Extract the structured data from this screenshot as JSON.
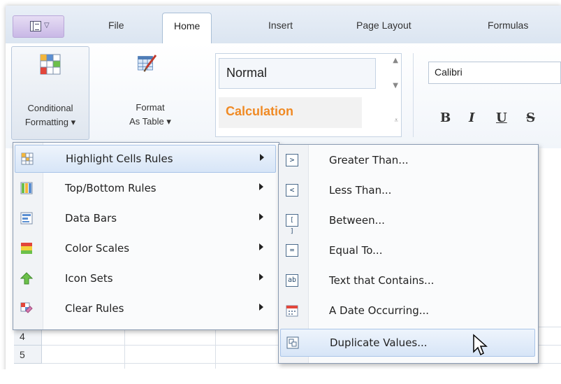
{
  "window": {
    "tabs": [
      {
        "label": "File",
        "active": false
      },
      {
        "label": "Home",
        "active": true
      },
      {
        "label": "Insert",
        "active": false
      },
      {
        "label": "Page Layout",
        "active": false
      },
      {
        "label": "Formulas",
        "active": false
      }
    ]
  },
  "ribbon": {
    "conditional_formatting": {
      "line1": "Conditional",
      "line2": "Formatting ▾"
    },
    "format_as_table": {
      "line1": "Format",
      "line2": "As Table ▾"
    },
    "styles": {
      "normal": "Normal",
      "calculation": "Calculation",
      "calculation_color": "#f08a24"
    },
    "font": {
      "name": "Calibri",
      "bold": "B",
      "italic": "I",
      "underline": "U",
      "strikethrough": "S"
    }
  },
  "sheet": {
    "rows": [
      "4",
      "5"
    ]
  },
  "menu": {
    "items": [
      {
        "label": "Highlight Cells Rules",
        "icon": "highlight-cells-icon",
        "highlighted": true
      },
      {
        "label": "Top/Bottom Rules",
        "icon": "top-bottom-icon",
        "highlighted": false
      },
      {
        "label": "Data Bars",
        "icon": "data-bars-icon",
        "highlighted": false
      },
      {
        "label": "Color Scales",
        "icon": "color-scales-icon",
        "highlighted": false
      },
      {
        "label": "Icon Sets",
        "icon": "icon-sets-icon",
        "highlighted": false
      },
      {
        "label": "Clear Rules",
        "icon": "clear-rules-icon",
        "highlighted": false
      }
    ]
  },
  "submenu": {
    "items": [
      {
        "label": "Greater Than...",
        "icon": "greater-than-icon",
        "glyph": ">"
      },
      {
        "label": "Less Than...",
        "icon": "less-than-icon",
        "glyph": "<"
      },
      {
        "label": "Between...",
        "icon": "between-icon",
        "glyph": "[ ]"
      },
      {
        "label": "Equal To...",
        "icon": "equal-to-icon",
        "glyph": "="
      },
      {
        "label": "Text that Contains...",
        "icon": "text-contains-icon",
        "glyph": "ab"
      },
      {
        "label": "A Date Occurring...",
        "icon": "date-occurring-icon",
        "glyph": ""
      },
      {
        "label": "Duplicate Values...",
        "icon": "duplicate-values-icon",
        "glyph": "",
        "highlighted": true
      }
    ]
  },
  "colors": {
    "accent": "#a9c4e8",
    "highlight_bg": "#d7e5f7",
    "menu_border": "#8a9bb2"
  }
}
